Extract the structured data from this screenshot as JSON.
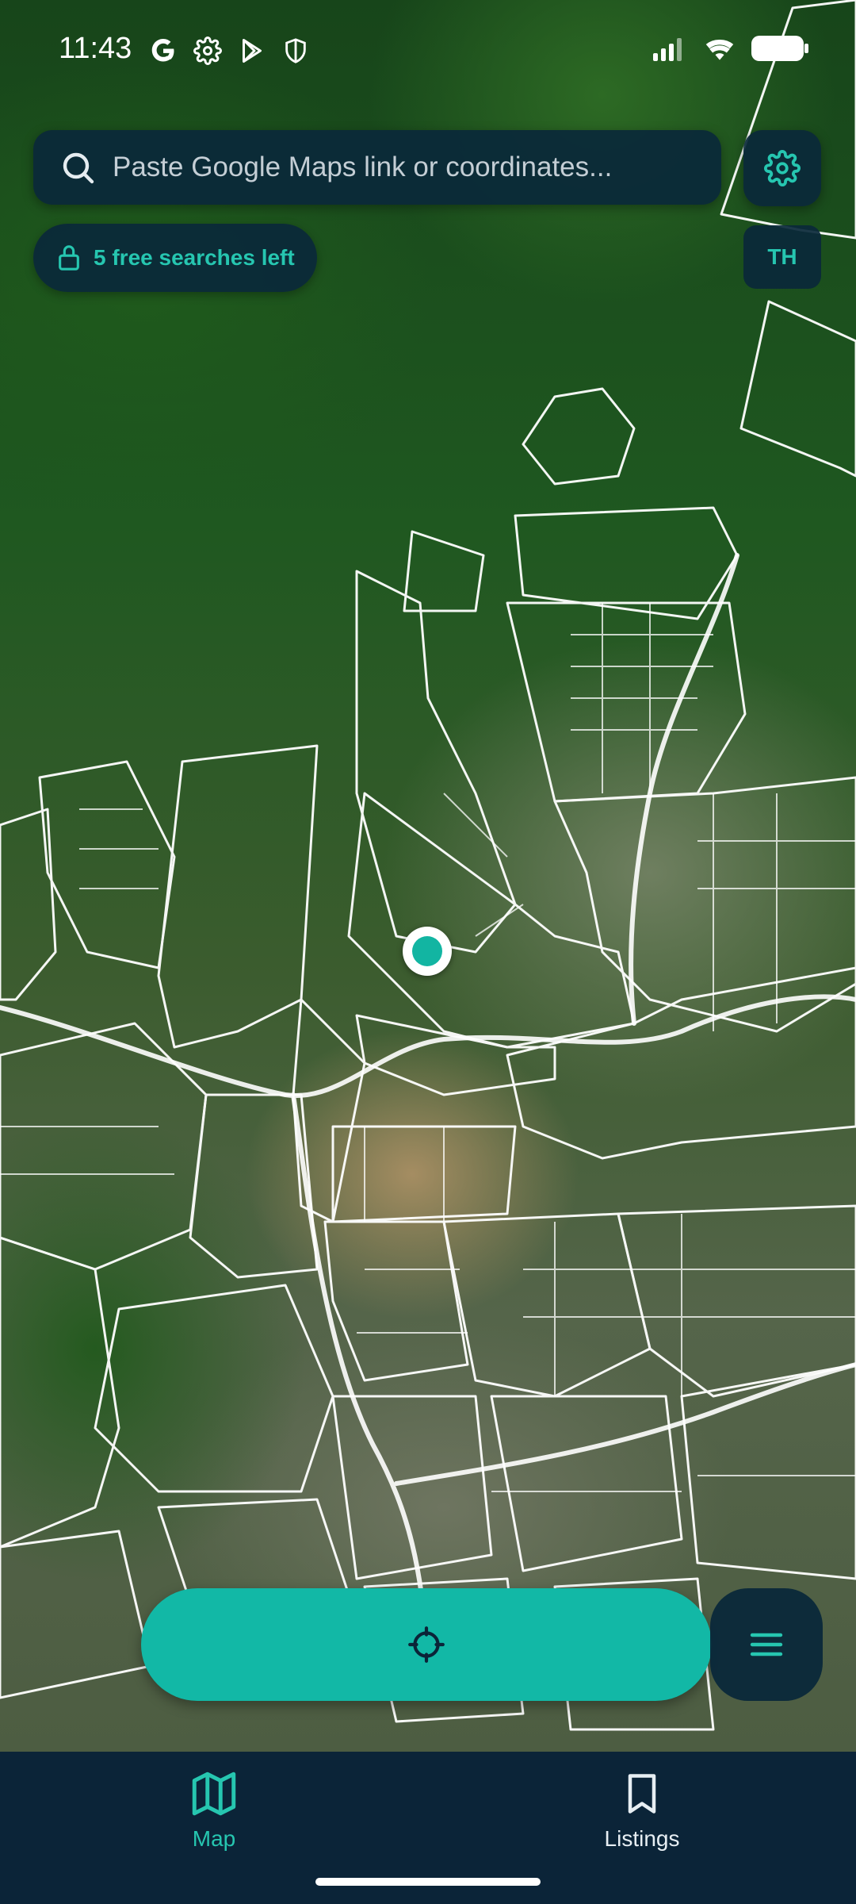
{
  "status_bar": {
    "time": "11:43",
    "left_icons": [
      "google-icon",
      "settings-icon",
      "play-store-icon",
      "shield-icon"
    ],
    "right_icons": [
      "signal-icon",
      "wifi-icon",
      "battery-icon"
    ]
  },
  "search": {
    "placeholder": "Paste Google Maps link or coordinates...",
    "value": ""
  },
  "quota": {
    "label": "5 free searches left"
  },
  "language": {
    "code": "TH"
  },
  "nav": {
    "items": [
      {
        "label": "Map",
        "icon": "map-icon",
        "active": true
      },
      {
        "label": "Listings",
        "icon": "bookmark-icon",
        "active": false
      }
    ]
  },
  "colors": {
    "accent": "#12b8a6",
    "panel": "#0a283a",
    "nav_bg": "#0b2438"
  }
}
